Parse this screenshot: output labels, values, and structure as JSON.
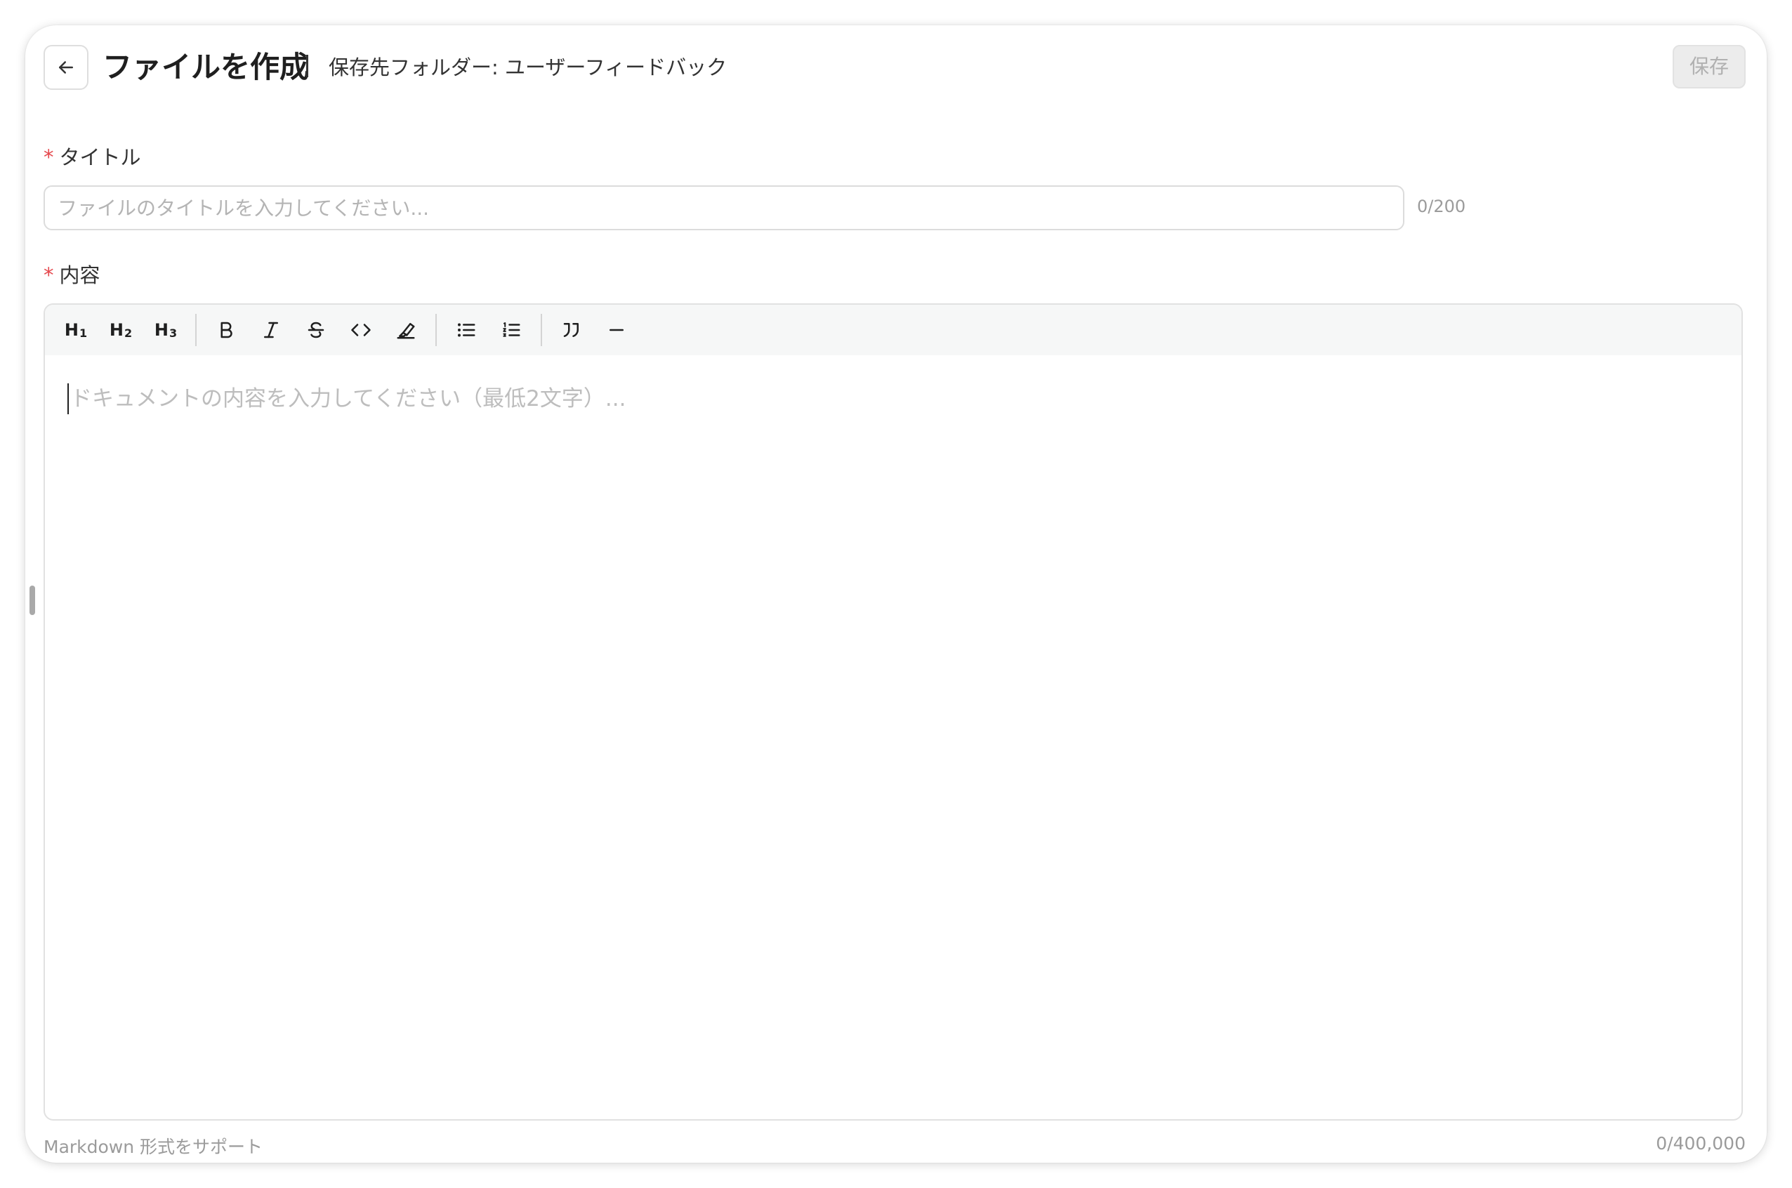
{
  "header": {
    "back_icon": "arrow-left-icon",
    "title": "ファイルを作成",
    "folder_label": "保存先フォルダー: ユーザーフィードバック",
    "save_label": "保存"
  },
  "form": {
    "title_field": {
      "required_mark": "*",
      "label": "タイトル",
      "placeholder": "ファイルのタイトルを入力してください...",
      "value": "",
      "counter": "0/200"
    },
    "content_field": {
      "required_mark": "*",
      "label": "内容",
      "placeholder": "ドキュメントの内容を入力してください（最低2文字）...",
      "counter": "0/400,000",
      "hint": "Markdown 形式をサポート"
    }
  },
  "toolbar": {
    "items": [
      {
        "icon": "heading-1-icon",
        "label": "H",
        "sub": "1"
      },
      {
        "icon": "heading-2-icon",
        "label": "H",
        "sub": "2"
      },
      {
        "icon": "heading-3-icon",
        "label": "H",
        "sub": "3"
      },
      {
        "icon": "bold-icon"
      },
      {
        "icon": "italic-icon"
      },
      {
        "icon": "strikethrough-icon"
      },
      {
        "icon": "code-icon"
      },
      {
        "icon": "highlight-icon"
      },
      {
        "icon": "bullet-list-icon"
      },
      {
        "icon": "ordered-list-icon"
      },
      {
        "icon": "blockquote-icon"
      },
      {
        "icon": "horizontal-rule-icon"
      }
    ]
  },
  "colors": {
    "required": "#e5484d",
    "toolbar_bg": "#f6f7f7",
    "save_disabled_bg": "#ececec",
    "placeholder": "#b4b4b4"
  }
}
